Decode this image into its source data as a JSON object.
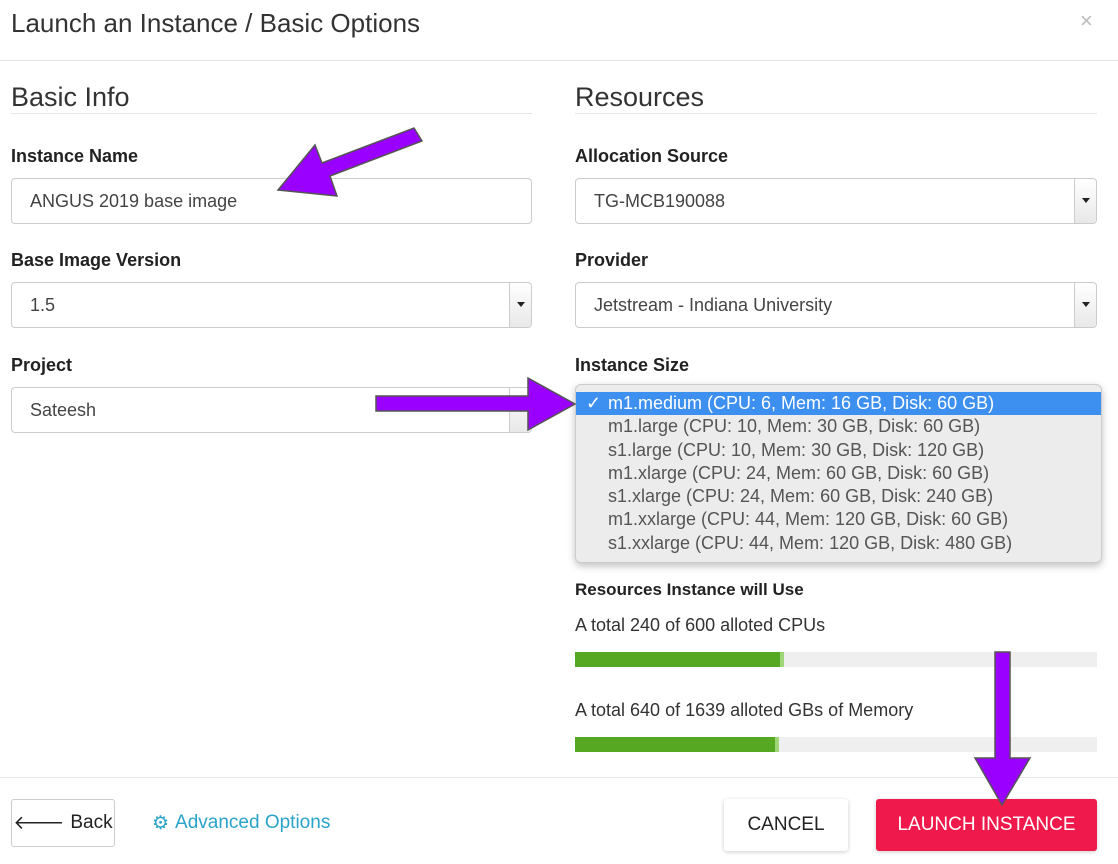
{
  "header": {
    "title": "Launch an Instance / Basic Options",
    "close_icon": "×"
  },
  "basic_info": {
    "heading": "Basic Info",
    "instance_name": {
      "label": "Instance Name",
      "value": "ANGUS 2019 base image"
    },
    "base_image_version": {
      "label": "Base Image Version",
      "value": "1.5"
    },
    "project": {
      "label": "Project",
      "value": "Sateesh"
    }
  },
  "resources": {
    "heading": "Resources",
    "allocation_source": {
      "label": "Allocation Source",
      "value": "TG-MCB190088"
    },
    "provider": {
      "label": "Provider",
      "value": "Jetstream - Indiana University"
    },
    "instance_size": {
      "label": "Instance Size",
      "selected": "m1.medium (CPU: 6, Mem: 16 GB, Disk: 60 GB)",
      "check": "✓",
      "options": [
        "m1.medium (CPU: 6, Mem: 16 GB, Disk: 60 GB)",
        "m1.large (CPU: 10, Mem: 30 GB, Disk: 60 GB)",
        "s1.large (CPU: 10, Mem: 30 GB, Disk: 120 GB)",
        "m1.xlarge (CPU: 24, Mem: 60 GB, Disk: 60 GB)",
        "s1.xlarge (CPU: 24, Mem: 60 GB, Disk: 240 GB)",
        "m1.xxlarge (CPU: 44, Mem: 120 GB, Disk: 60 GB)",
        "s1.xxlarge (CPU: 44, Mem: 120 GB, Disk: 480 GB)"
      ]
    },
    "usage_heading": "Resources Instance will Use",
    "cpu": {
      "text": "A total 240 of 600 alloted CPUs",
      "percent": 40
    },
    "memory": {
      "text": "A total 640 of 1639 alloted GBs of Memory",
      "percent": 39
    }
  },
  "footer": {
    "back": "Back",
    "advanced": "Advanced Options",
    "cancel": "CANCEL",
    "launch": "LAUNCH INSTANCE"
  },
  "colors": {
    "accent": "#f0194b",
    "link": "#2aa3c9",
    "progress": "#56a822",
    "highlight": "#3d8ff0",
    "annotation_arrow": "#9900ff"
  }
}
